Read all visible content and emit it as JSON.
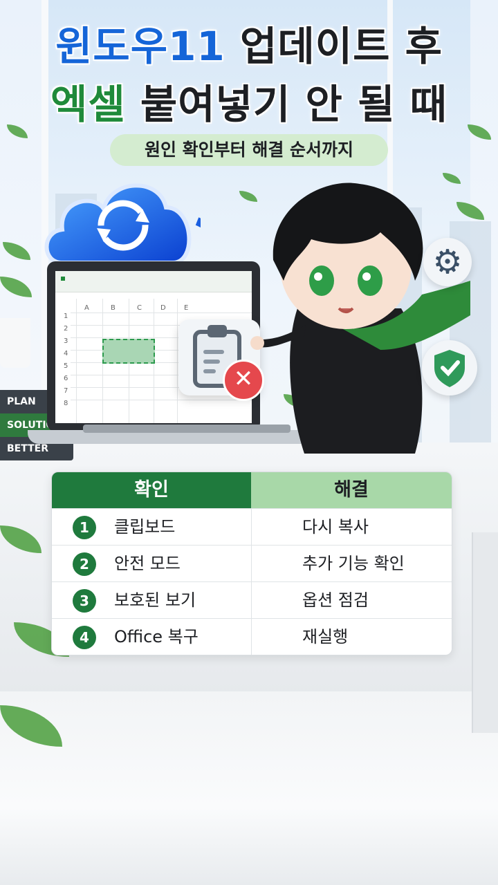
{
  "title": {
    "line1_part1": "윈도우11",
    "line1_part2": "업데이트 후",
    "line2_part1": "엑셀",
    "line2_part2": "붙여넣기 안 될 때"
  },
  "subtitle": "원인 확인부터 해결 순서까지",
  "spreadsheet": {
    "columns": [
      "A",
      "B",
      "C",
      "D",
      "E"
    ],
    "rows": [
      "1",
      "2",
      "3",
      "4",
      "5",
      "6",
      "7",
      "8"
    ]
  },
  "books": [
    "PLAN",
    "SOLUTION",
    "BETTER"
  ],
  "table": {
    "header_check": "확인",
    "header_fix": "해결",
    "rows": [
      {
        "num": "1",
        "check": "클립보드",
        "fix": "다시 복사"
      },
      {
        "num": "2",
        "check": "안전 모드",
        "fix": "추가 기능 확인"
      },
      {
        "num": "3",
        "check": "보호된 보기",
        "fix": "옵션 점검"
      },
      {
        "num": "4",
        "check": "Office 복구",
        "fix": "재실행"
      }
    ]
  },
  "icons": {
    "sync": "sync-cloud-icon",
    "clipboard": "clipboard-icon",
    "error": "x-circle-icon",
    "gear": "gear-icon",
    "shield": "shield-check-icon"
  },
  "colors": {
    "title_blue": "#1565d8",
    "title_green": "#1f8a3a",
    "table_header_green": "#1f7a3d",
    "table_header_light": "#a8d8a8",
    "error_red": "#e5484d"
  }
}
